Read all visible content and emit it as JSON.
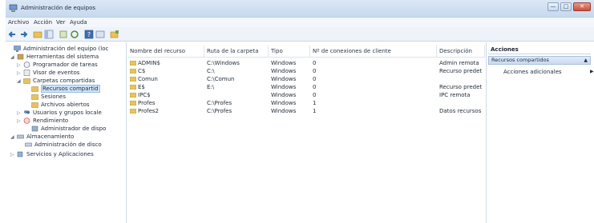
{
  "window": {
    "title": "Administración de equipos",
    "buttons": {
      "minimize": "—",
      "maximize": "□",
      "close": "✕"
    }
  },
  "menu": [
    "Archivo",
    "Acción",
    "Ver",
    "Ayuda"
  ],
  "toolbar": {
    "icons": [
      "back-arrow-icon",
      "forward-arrow-icon",
      "up-folder-icon",
      "show-hide-tree-icon",
      "export-icon",
      "refresh-icon",
      "help-icon",
      "properties-icon",
      "new-share-icon"
    ],
    "accent": "#2f6fb3"
  },
  "tree": [
    {
      "label": "Administración del equipo (loc",
      "icon": "computer-icon",
      "twisty": ""
    },
    {
      "label": "Herramientas del sistema",
      "icon": "tools-icon",
      "twisty": "◢"
    },
    {
      "label": "Programador de tareas",
      "icon": "clock-icon",
      "twisty": "▷"
    },
    {
      "label": "Visor de eventos",
      "icon": "event-viewer-icon",
      "twisty": "▷"
    },
    {
      "label": "Carpetas compartidas",
      "icon": "shared-folder-icon",
      "twisty": "◢"
    },
    {
      "label": "Recursos compartid",
      "icon": "shared-folder-icon",
      "twisty": ""
    },
    {
      "label": "Sesiones",
      "icon": "shared-folder-icon",
      "twisty": ""
    },
    {
      "label": "Archivos abiertos",
      "icon": "shared-folder-icon",
      "twisty": ""
    },
    {
      "label": "Usuarios y grupos locale",
      "icon": "users-icon",
      "twisty": "▷"
    },
    {
      "label": "Rendimiento",
      "icon": "performance-icon",
      "twisty": "▷"
    },
    {
      "label": "Administrador de dispo",
      "icon": "device-manager-icon",
      "twisty": ""
    },
    {
      "label": "Almacenamiento",
      "icon": "storage-icon",
      "twisty": "◢"
    },
    {
      "label": "Administración de disco",
      "icon": "disk-icon",
      "twisty": ""
    },
    {
      "label": "Servicios y Aplicaciones",
      "icon": "services-icon",
      "twisty": "▷"
    }
  ],
  "shares_table": {
    "columns": [
      "Nombre del recurso",
      "Ruta de la carpeta",
      "Tipo",
      "Nº de conexiones de cliente",
      "Descripción"
    ],
    "rows": [
      [
        "ADMIN$",
        "C:\\Windows",
        "Windows",
        "0",
        "Admin remota"
      ],
      [
        "C$",
        "C:\\",
        "Windows",
        "0",
        "Recurso predet"
      ],
      [
        "Comun",
        "C:\\Comun",
        "Windows",
        "0",
        ""
      ],
      [
        "E$",
        "E:\\",
        "Windows",
        "0",
        "Recurso predet"
      ],
      [
        "IPC$",
        "",
        "Windows",
        "0",
        "IPC remota"
      ],
      [
        "Profes",
        "C:\\Profes",
        "Windows",
        "1",
        ""
      ],
      [
        "Profes2",
        "C:\\Profes",
        "Windows",
        "1",
        "Datos recursos"
      ]
    ]
  },
  "actions": {
    "title": "Acciones",
    "section": "Recursos compartidos",
    "section_caret": "▲",
    "more": "Acciones adicionales",
    "more_arrow": "▶"
  }
}
